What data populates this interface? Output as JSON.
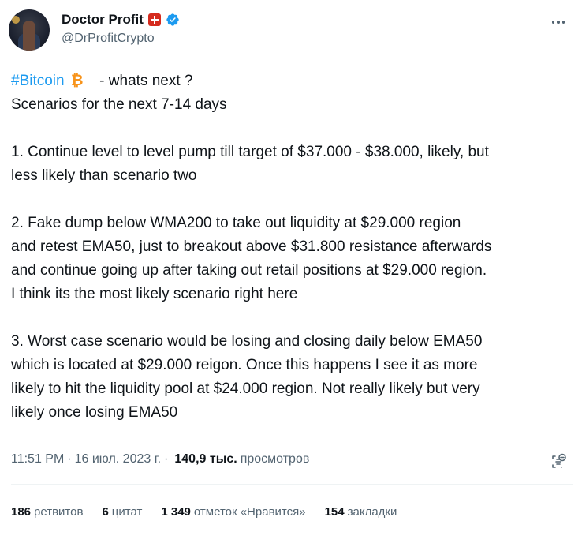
{
  "author": {
    "name": "Doctor Profit",
    "handle": "@DrProfitCrypto"
  },
  "tweet": {
    "hashtag": "#Bitcoin",
    "headline_rest": " - whats next ?",
    "lines": [
      "Scenarios for the next 7-14 days",
      "",
      "1. Continue level to level pump till target of $37.000 - $38.000, likely, but",
      "less likely than scenario two",
      "",
      "2. Fake dump below WMA200 to take out liquidity at $29.000 region",
      "and retest EMA50, just to breakout above $31.800 resistance afterwards",
      "and continue going up after taking out retail positions at $29.000 region.",
      "I think its the most likely scenario right here",
      "",
      "3. Worst case scenario would be losing and closing daily below EMA50",
      "which is located at $29.000 reigon. Once this happens I see it as more",
      "likely to hit the liquidity pool at $24.000 region. Not really likely but very",
      "likely once losing EMA50"
    ]
  },
  "meta": {
    "time": "11:51 PM",
    "separator": "·",
    "date": "16 июл. 2023 г.",
    "views_count": "140,9 тыс.",
    "views_label": "просмотров"
  },
  "stats": [
    {
      "num": "186",
      "label": "ретвитов"
    },
    {
      "num": "6",
      "label": "цитат"
    },
    {
      "num": "1 349",
      "label": "отметок «Нравится»"
    },
    {
      "num": "154",
      "label": "закладки"
    }
  ],
  "colors": {
    "link": "#1d9bf0",
    "secondary_text": "#536471",
    "bitcoin": "#f7931a",
    "verified": "#1d9bf0"
  }
}
